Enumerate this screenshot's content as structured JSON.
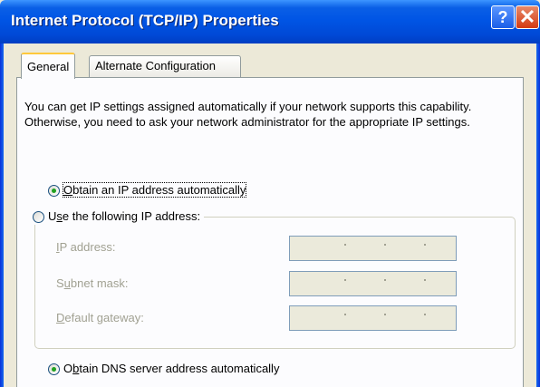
{
  "window": {
    "title": "Internet Protocol (TCP/IP) Properties",
    "help_icon": "?",
    "close_icon": "✕"
  },
  "tabs": [
    {
      "label": "General",
      "active": true
    },
    {
      "label": "Alternate Configuration",
      "active": false
    }
  ],
  "general": {
    "description": "You can get IP settings assigned automatically if your network supports this capability. Otherwise, you need to ask your network administrator for the appropriate IP settings.",
    "ip_options": [
      {
        "label_pre": "",
        "accel": "O",
        "label_post": "btain an IP address automatically",
        "checked": true
      },
      {
        "label_pre": "U",
        "accel": "s",
        "label_post": "e the following IP address:",
        "checked": false
      }
    ],
    "fields": [
      {
        "label_pre": "",
        "accel": "I",
        "label_post": "P address:",
        "value": "",
        "enabled": false
      },
      {
        "label_pre": "S",
        "accel": "u",
        "label_post": "bnet mask:",
        "value": "",
        "enabled": false
      },
      {
        "label_pre": "",
        "accel": "D",
        "label_post": "efault gateway:",
        "value": "",
        "enabled": false
      }
    ],
    "dns_options": [
      {
        "label_pre": "O",
        "accel": "b",
        "label_post": "tain DNS server address automatically",
        "checked": true
      }
    ]
  },
  "colors": {
    "titlebar": "#0055e5",
    "dialog_bg": "#ece9d8",
    "panel_bg": "#fcfcfe",
    "disabled_text": "#a1a192",
    "radio_dot": "#21a121"
  }
}
